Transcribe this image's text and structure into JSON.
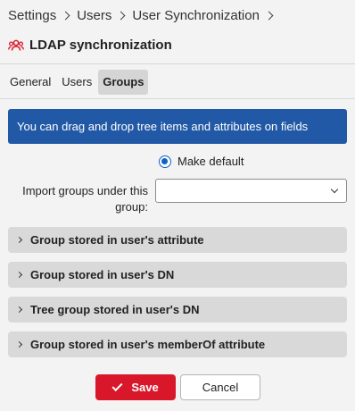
{
  "breadcrumb": [
    "Settings",
    "Users",
    "User Synchronization"
  ],
  "page": {
    "title": "LDAP synchronization",
    "icon": "users-icon",
    "icon_color": "#d8182a"
  },
  "tabs": [
    {
      "label": "General",
      "active": false
    },
    {
      "label": "Users",
      "active": false
    },
    {
      "label": "Groups",
      "active": true
    }
  ],
  "info_banner": {
    "text": "You can drag and drop tree items and attributes on fields",
    "color": "#2259a6"
  },
  "make_default": {
    "label": "Make default",
    "checked": true
  },
  "import_groups": {
    "label_line1": "Import groups under this",
    "label_line2": "group:",
    "value": ""
  },
  "sections": [
    {
      "label": "Group stored in user's attribute"
    },
    {
      "label": "Group stored in user's DN"
    },
    {
      "label": "Tree group stored in user's DN"
    },
    {
      "label": "Group stored in user's memberOf attribute"
    }
  ],
  "actions": {
    "save_label": "Save",
    "cancel_label": "Cancel",
    "save_color": "#d8182a"
  }
}
